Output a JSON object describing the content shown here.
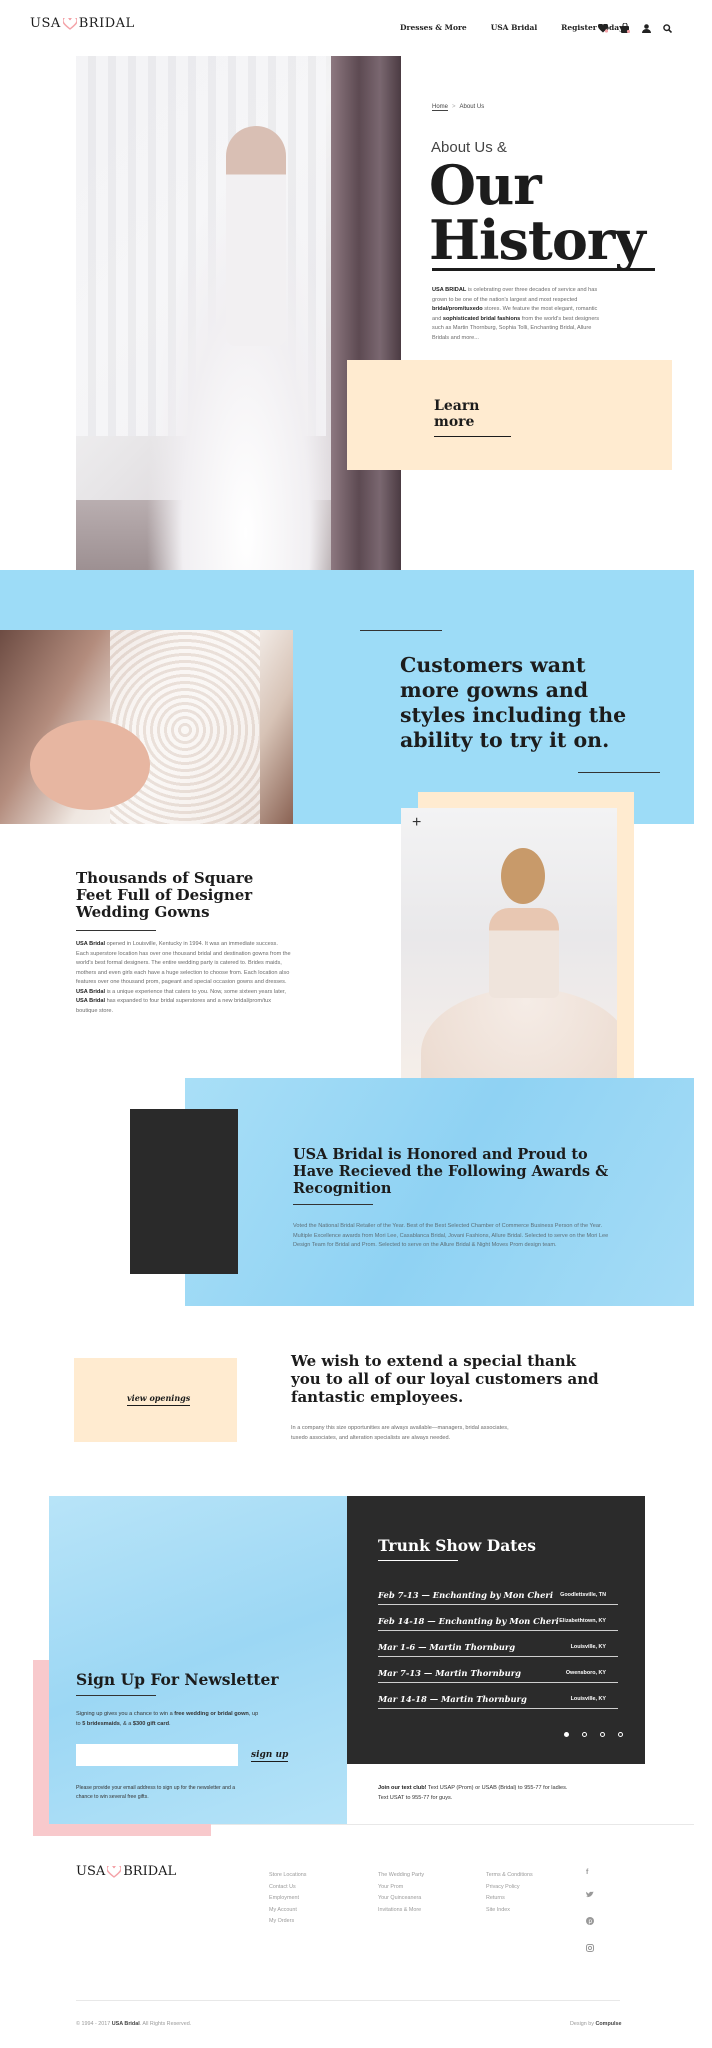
{
  "brand": {
    "name_left": "USA",
    "name_right": "BRIDAL",
    "accent": "#f4a3a8"
  },
  "nav": {
    "items": [
      "Dresses & More",
      "USA Bridal",
      "Register Today"
    ],
    "icons": [
      "heart-icon",
      "bag-icon",
      "user-icon",
      "search-icon"
    ]
  },
  "breadcrumb": {
    "home": "Home",
    "separator": ">",
    "current": "About Us"
  },
  "hero": {
    "eyebrow": "About Us &",
    "title_line1": "Our",
    "title_line2": "History",
    "para_1": "USA BRIDAL",
    "para_2": " is celebrating over three decades of service and has grown to be one of the nation's largest and most respected ",
    "para_3": "bridal/prom/tuxedo",
    "para_4": " stores. We feature the most elegant, romantic and ",
    "para_5": "sophisticated bridal fashions",
    "para_6": " from the world's best designers such as Martin Thornburg, Sophia Tolli, Enchanting Bridal, Allure Bridals and more...",
    "cta": "Learn more"
  },
  "customers": {
    "heading": "Customers want more gowns and styles including the ability to try it on."
  },
  "square_feet": {
    "heading": "Thousands of Square Feet Full of Designer Wedding Gowns",
    "p1_bold": "USA Bridal",
    "p1": " opened in Louisville, Kentucky in 1994. It was an immediate success. Each superstore location has over one thousand bridal and destination gowns from the world's best formal designers. The entire wedding party is catered to. Brides maids, mothers and even girls each have a huge selection to choose from. Each location also features over one thousand prom, pageant and special occasion gowns and dresses. ",
    "p2_bold": "USA Bridal",
    "p2": " is a unique experience that caters to you. Now, some sixteen years later, ",
    "p3_bold": "USA Bridal",
    "p3": " has expanded to four bridal superstores and a new bridal/prom/tux boutique store.",
    "plus": "+"
  },
  "awards": {
    "heading": "USA Bridal is Honored and Proud to Have Recieved the Following Awards & Recognition",
    "text": "Voted the National Bridal Retailer of the Year. Best of the Best Selected Chamber of Commerce Business Person of the Year. Multiple Excellence awards from Mori Lee, Casablanca Bridal, Jovani Fashions, Allure Bridal. Selected to serve on the Mori Lee Design Team for Bridal and Prom. Selected to serve on the Allure Bridal & Night Moves Prom design team."
  },
  "thanks": {
    "cta": "view openings",
    "heading": "We wish to extend a special thank you to all of our loyal customers and fantastic employees.",
    "text": "In a company this size opportunities are always available—managers, bridal associates, tuxedo associates, and alteration specialists are always needed."
  },
  "newsletter": {
    "heading": "Sign Up For Newsletter",
    "text_1": "Signing up gives you a chance to win a ",
    "text_2": "free wedding or bridal gown",
    "text_3": ", up to ",
    "text_4": "5 bridesmaids",
    "text_5": ", & a ",
    "text_6": "$300 gift card",
    "text_7": ".",
    "input_placeholder": "",
    "button": "sign up",
    "note": "Please provide your email address to sign up for the newsletter and a chance to win several free gifts."
  },
  "trunk": {
    "heading": "Trunk Show Dates",
    "rows": [
      {
        "date": "Feb 7-13",
        "title": "Enchanting by Mon Cheri",
        "location": "Goodlettsville, TN"
      },
      {
        "date": "Feb 14-18",
        "title": "Enchanting by Mon Cheri",
        "location": "Elizabethtown, KY"
      },
      {
        "date": "Mar 1-6",
        "title": "Martin Thornburg",
        "location": "Louisville, KY"
      },
      {
        "date": "Mar 7-13",
        "title": "Martin Thornburg",
        "location": "Owensboro, KY"
      },
      {
        "date": "Mar 14-18",
        "title": "Martin Thornburg",
        "location": "Louisville, KY"
      }
    ],
    "dash": "—",
    "text_club_bold": "Join our text club!",
    "text_club": " Text USAP (Prom) or USAB (Bridal) to 955-77 for ladies. Text USAT to 955-77 for guys."
  },
  "footer": {
    "col1": [
      "Store Locations",
      "Contact Us",
      "Employment",
      "My Account",
      "My Orders"
    ],
    "col2": [
      "The Wedding Party",
      "Your Prom",
      "Your Quinceanera",
      "Invitations & More"
    ],
    "col3": [
      "Terms & Conditions",
      "Privacy Policy",
      "Returns",
      "Site Index"
    ],
    "social": [
      "facebook-icon",
      "twitter-icon",
      "pinterest-icon",
      "instagram-icon"
    ],
    "copyright_1": "© 1994 - 2017 ",
    "copyright_2": "USA Bridal",
    "copyright_3": ". All Rights Reserved.",
    "design_by_1": "Design by ",
    "design_by_2": "Compulse"
  }
}
